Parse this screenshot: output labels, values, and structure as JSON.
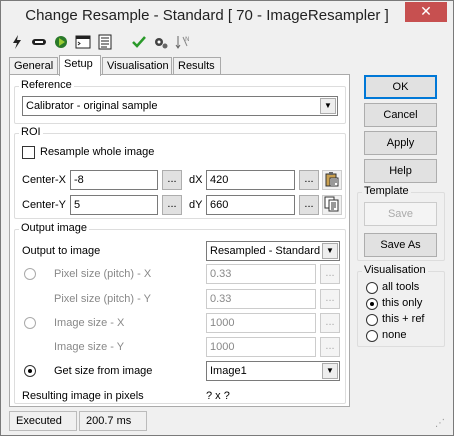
{
  "window": {
    "title": "Change Resample - Standard [ 70 - ImageResampler ]",
    "close": "✕"
  },
  "toolbar": {
    "icons": [
      "lightning-icon",
      "link-icon",
      "run-icon",
      "console-icon",
      "list-icon",
      "check-icon",
      "settings-icon",
      "sort-icon"
    ]
  },
  "tabs": [
    "General",
    "Setup",
    "Visualisation",
    "Results"
  ],
  "reference": {
    "group_label": "Reference",
    "selected": "Calibrator - original sample"
  },
  "roi": {
    "group_label": "ROI",
    "resample_whole_label": "Resample whole image",
    "center_x_label": "Center-X",
    "center_x_value": "-8",
    "center_y_label": "Center-Y",
    "center_y_value": "5",
    "dx_label": "dX",
    "dx_value": "420",
    "dy_label": "dY",
    "dy_value": "660",
    "ellipsis": "..."
  },
  "output": {
    "group_label": "Output image",
    "output_to_label": "Output to image",
    "output_to_value": "Resampled - Standard",
    "pixel_x_label": "Pixel size (pitch) - X",
    "pixel_x_value": "0.33",
    "pixel_y_label": "Pixel size (pitch) - Y",
    "pixel_y_value": "0.33",
    "image_x_label": "Image size - X",
    "image_x_value": "1000",
    "image_y_label": "Image size - Y",
    "image_y_value": "1000",
    "get_size_label": "Get size from image",
    "get_size_value": "Image1",
    "result_label": "Resulting image in pixels",
    "result_value": "? x ?"
  },
  "buttons": {
    "ok": "OK",
    "cancel": "Cancel",
    "apply": "Apply",
    "help": "Help"
  },
  "template": {
    "group_label": "Template",
    "save": "Save",
    "save_as": "Save As"
  },
  "visualisation": {
    "group_label": "Visualisation",
    "options": [
      "all tools",
      "this only",
      "this + ref",
      "none"
    ],
    "selected_index": 1
  },
  "status": {
    "state": "Executed",
    "time": "200.7 ms"
  }
}
